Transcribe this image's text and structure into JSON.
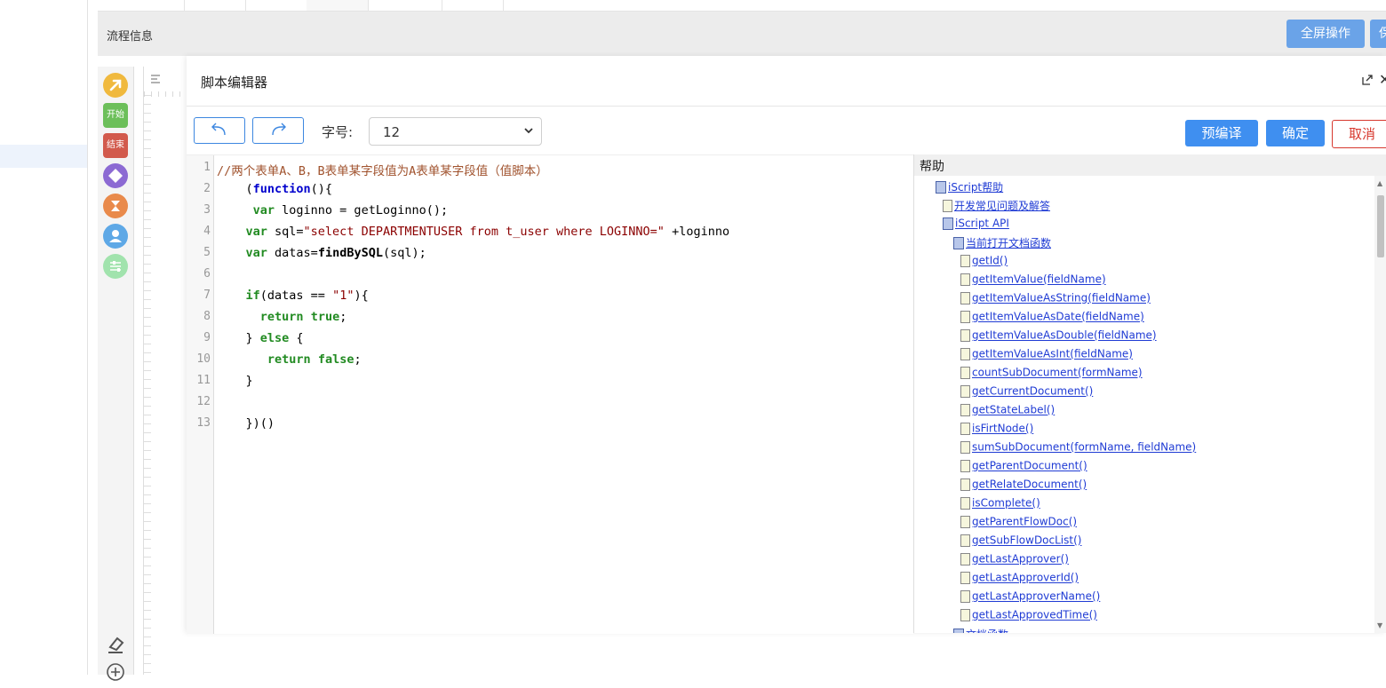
{
  "flow": {
    "title": "流程信息",
    "fullscreen_label": "全屏操作",
    "cut_label": "保存"
  },
  "palette": {
    "start_label": "开始",
    "end_label": "结束"
  },
  "modal": {
    "title": "脚本编辑器",
    "fontsize_label": "字号:",
    "fontsize_value": "12",
    "precompile_label": "预编译",
    "confirm_label": "确定",
    "cancel_label": "取消"
  },
  "editor": {
    "line_numbers": [
      "1",
      "2",
      "3",
      "4",
      "5",
      "6",
      "7",
      "8",
      "9",
      "10",
      "11",
      "12",
      "13"
    ],
    "comment": "//两个表单A、B，B表单某字段值为A表单某字段值（值脚本）",
    "l2_function": "function",
    "l3_var": "var",
    "l3_rest": " loginno = getLoginno();",
    "l4_var": "var",
    "l4_sql_name": " sql=",
    "l4_string": "\"select DEPARTMENTUSER from t_user where LOGINNO=\"",
    "l4_rest": " +loginno",
    "l5_var": "var",
    "l5_name": " datas=",
    "l5_fn": "findBySQL",
    "l5_rest": "(sql);",
    "l7_if": "if",
    "l7_cond": "(datas == ",
    "l7_string": "\"1\"",
    "l7_rest": "){",
    "l8_return": "return",
    "l8_true": "true",
    "l9_open": "} ",
    "l9_else": "else",
    "l9_rest": " {",
    "l10_return": "return",
    "l10_false": "false",
    "l11": "}",
    "l13": "})()"
  },
  "help": {
    "title": "帮助",
    "tree": [
      {
        "label": "iScript帮助",
        "icon": "book-icon",
        "level": 0
      },
      {
        "label": "开发常见问题及解答",
        "icon": "doc-icon",
        "level": 1
      },
      {
        "label": "iScript API",
        "icon": "book-icon",
        "level": 1
      },
      {
        "label": "当前打开文档函数",
        "icon": "book-icon",
        "level": 2
      },
      {
        "label": "getId()",
        "icon": "doc-icon",
        "level": 3
      },
      {
        "label": "getItemValue(fieldName)",
        "icon": "doc-icon",
        "level": 3
      },
      {
        "label": "getItemValueAsString(fieldName)",
        "icon": "doc-icon",
        "level": 3
      },
      {
        "label": "getItemValueAsDate(fieldName)",
        "icon": "doc-icon",
        "level": 3
      },
      {
        "label": "getItemValueAsDouble(fieldName)",
        "icon": "doc-icon",
        "level": 3
      },
      {
        "label": "getItemValueAsInt(fieldName)",
        "icon": "doc-icon",
        "level": 3
      },
      {
        "label": "countSubDocument(formName)",
        "icon": "doc-icon",
        "level": 3
      },
      {
        "label": "getCurrentDocument()",
        "icon": "doc-icon",
        "level": 3
      },
      {
        "label": "getStateLabel()",
        "icon": "doc-icon",
        "level": 3
      },
      {
        "label": "isFirtNode()",
        "icon": "doc-icon",
        "level": 3
      },
      {
        "label": "sumSubDocument(formName, fieldName)",
        "icon": "doc-icon",
        "level": 3
      },
      {
        "label": "getParentDocument()",
        "icon": "doc-icon",
        "level": 3
      },
      {
        "label": "getRelateDocument()",
        "icon": "doc-icon",
        "level": 3
      },
      {
        "label": "isComplete()",
        "icon": "doc-icon",
        "level": 3
      },
      {
        "label": "getParentFlowDoc()",
        "icon": "doc-icon",
        "level": 3
      },
      {
        "label": "getSubFlowDocList()",
        "icon": "doc-icon",
        "level": 3
      },
      {
        "label": "getLastApprover()",
        "icon": "doc-icon",
        "level": 3
      },
      {
        "label": "getLastApproverId()",
        "icon": "doc-icon",
        "level": 3
      },
      {
        "label": "getLastApproverName()",
        "icon": "doc-icon",
        "level": 3
      },
      {
        "label": "getLastApprovedTime()",
        "icon": "doc-icon",
        "level": 3
      },
      {
        "label": "文档函数",
        "icon": "book-icon",
        "level": 2
      }
    ]
  },
  "colors": {
    "primary": "#3f8ff0",
    "danger": "#d7382e",
    "link": "#1f3bd4"
  }
}
